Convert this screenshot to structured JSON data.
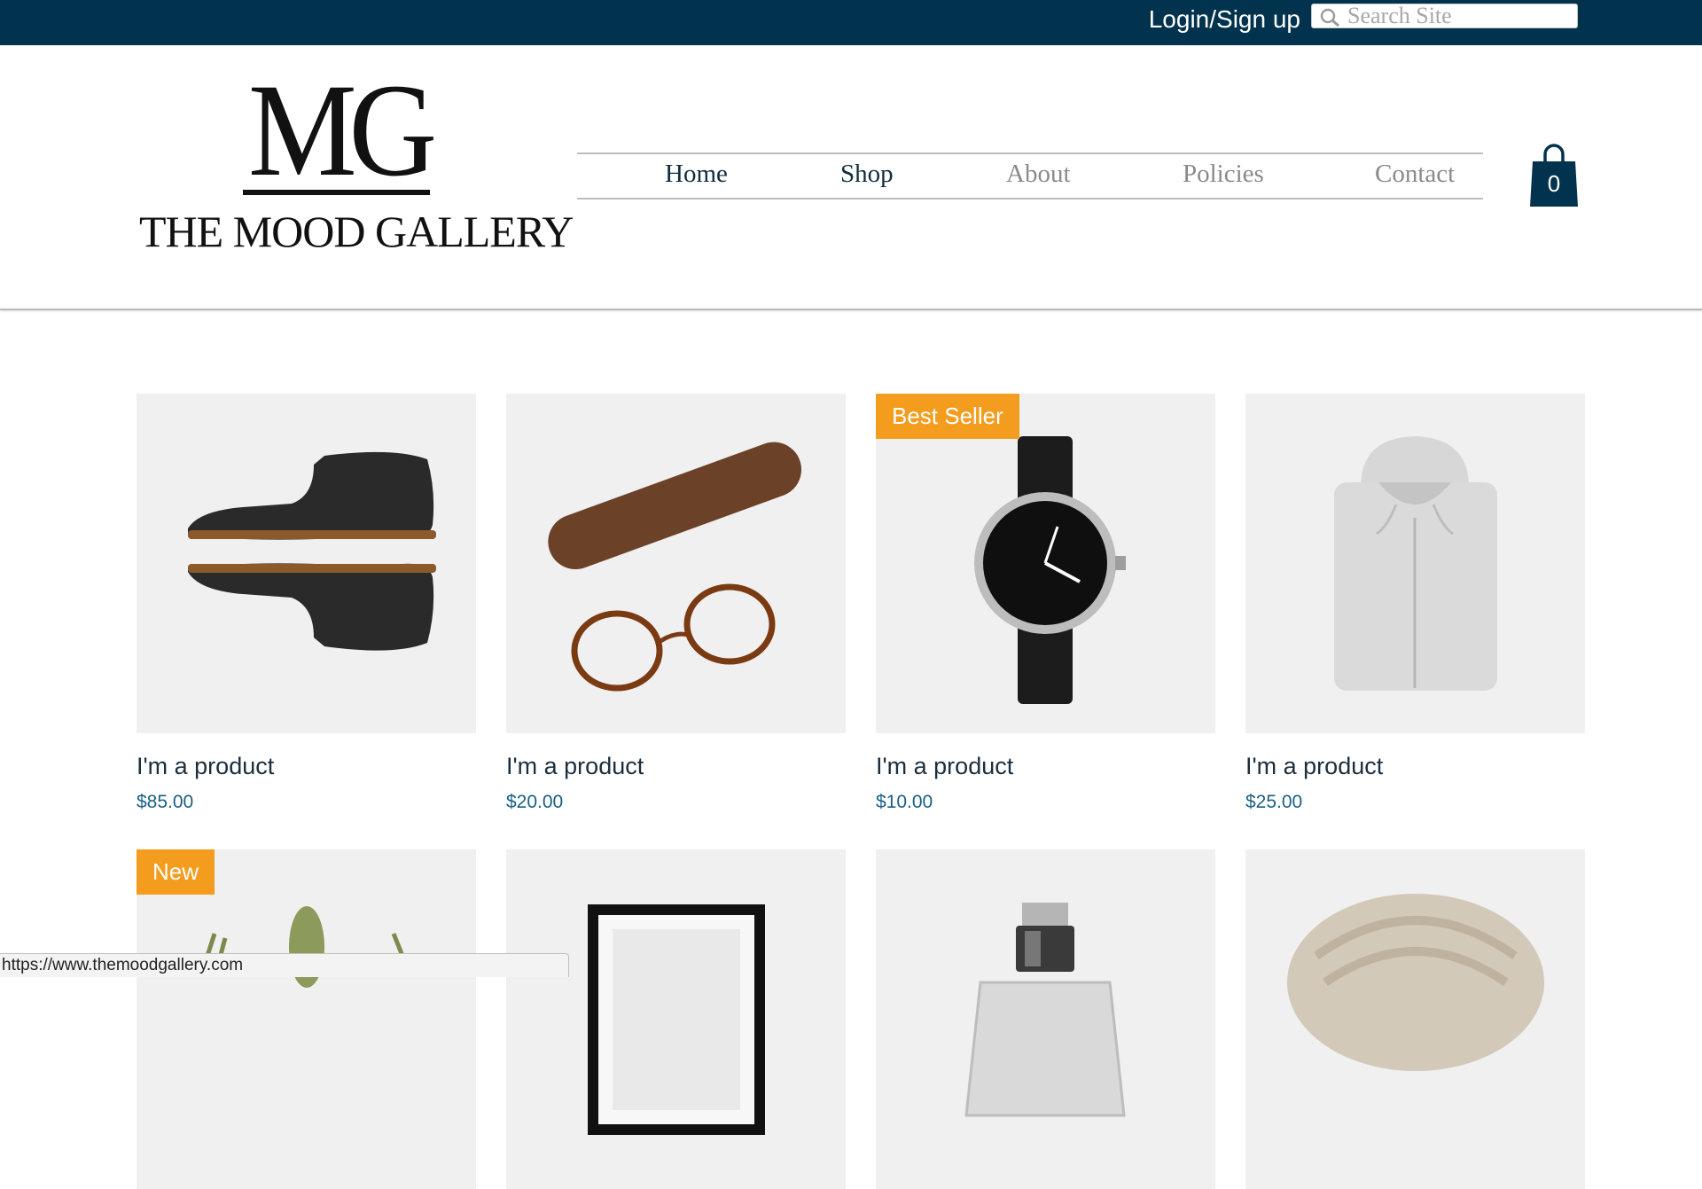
{
  "topbar": {
    "login_label": "Login/Sign up",
    "search_placeholder": "Search Site",
    "background": "#02334e"
  },
  "brand": {
    "monogram": "MG",
    "name": "THE MOOD GALLERY"
  },
  "nav": {
    "items": [
      {
        "label": "Home",
        "state": "active"
      },
      {
        "label": "Shop",
        "state": "active"
      },
      {
        "label": "About",
        "state": "normal"
      },
      {
        "label": "Policies",
        "state": "normal"
      },
      {
        "label": "Contact",
        "state": "normal"
      }
    ]
  },
  "cart": {
    "count": "0",
    "icon": "shopping-bag-icon"
  },
  "products": [
    {
      "name": "I'm a product",
      "price": "$85.00",
      "badge": "",
      "image": "leather-boots"
    },
    {
      "name": "I'm a product",
      "price": "$20.00",
      "badge": "",
      "image": "glasses-and-case"
    },
    {
      "name": "I'm a product",
      "price": "$10.00",
      "badge": "Best Seller",
      "image": "wristwatch"
    },
    {
      "name": "I'm a product",
      "price": "$25.00",
      "badge": "",
      "image": "grey-hoodie"
    },
    {
      "name": "",
      "price": "",
      "badge": "New",
      "image": "cactus-plant"
    },
    {
      "name": "",
      "price": "",
      "badge": "",
      "image": "picture-frame"
    },
    {
      "name": "",
      "price": "",
      "badge": "",
      "image": "perfume-bottle"
    },
    {
      "name": "",
      "price": "",
      "badge": "",
      "image": "knit-scarf"
    }
  ],
  "colors": {
    "accent": "#02334e",
    "badge": "#f49c1e",
    "price": "#1a5f82"
  },
  "status_bar": {
    "url": "https://www.themoodgallery.com"
  }
}
